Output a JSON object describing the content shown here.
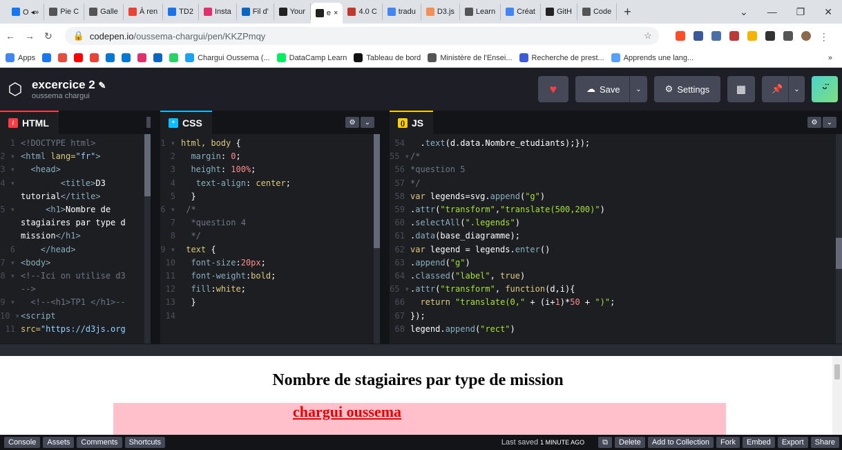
{
  "browser": {
    "tabs": [
      {
        "label": "O ◂»",
        "color": "#1877f2"
      },
      {
        "label": "Pie C",
        "color": "#555"
      },
      {
        "label": "Galle",
        "color": "#555"
      },
      {
        "label": "À ren",
        "color": "#ea4335"
      },
      {
        "label": "TD2",
        "color": "#1a73e8"
      },
      {
        "label": "Insta",
        "color": "#e1306c"
      },
      {
        "label": "Fil d'",
        "color": "#0a66c2"
      },
      {
        "label": "Your",
        "color": "#222"
      },
      {
        "label": "e",
        "color": "#222",
        "active": true
      },
      {
        "label": "4.0 C",
        "color": "#c0392b"
      },
      {
        "label": "tradu",
        "color": "#4285f4"
      },
      {
        "label": "D3.js",
        "color": "#f68e56"
      },
      {
        "label": "Learn",
        "color": "#555"
      },
      {
        "label": "Créat",
        "color": "#4285f4"
      },
      {
        "label": "GitH",
        "color": "#222"
      },
      {
        "label": "Code",
        "color": "#555"
      }
    ],
    "url_domain": "codepen.io",
    "url_path": "/oussema-chargui/pen/KKZPmqy",
    "bookmarks": [
      {
        "label": "Apps",
        "color": "#4285f4"
      },
      {
        "label": "",
        "color": "#1877f2"
      },
      {
        "label": "",
        "color": "#e74c3c"
      },
      {
        "label": "",
        "color": "#ff0000"
      },
      {
        "label": "",
        "color": "#ea4335"
      },
      {
        "label": "",
        "color": "#0078d4"
      },
      {
        "label": "",
        "color": "#0078d4"
      },
      {
        "label": "",
        "color": "#e1306c"
      },
      {
        "label": "",
        "color": "#0a66c2"
      },
      {
        "label": "",
        "color": "#25d366"
      },
      {
        "label": "Chargui Oussema (...",
        "color": "#1da1f2"
      },
      {
        "label": "DataCamp Learn",
        "color": "#03ef62"
      },
      {
        "label": "Tableau de bord",
        "color": "#111"
      },
      {
        "label": "Ministère de l'Ensei...",
        "color": "#555"
      },
      {
        "label": "Recherche de prest...",
        "color": "#3b5cd6"
      },
      {
        "label": "Apprends une lang...",
        "color": "#58a0ff"
      }
    ],
    "bookmarks_more": "»"
  },
  "codepen": {
    "title": "excercice 2",
    "author": "oussema chargui",
    "save_label": "Save",
    "settings_label": "Settings",
    "avatar_face": "̈ᴥ"
  },
  "panes": {
    "html_label": "HTML",
    "css_label": "CSS",
    "js_label": "JS"
  },
  "preview": {
    "title": "Nombre de stagiaires par type de mission",
    "name": "chargui oussema"
  },
  "footer": {
    "buttons_left": [
      "Console",
      "Assets",
      "Comments",
      "Shortcuts"
    ],
    "last_saved": "Last saved",
    "last_saved_time": "1 MINUTE AGO",
    "buttons_right": [
      "Delete",
      "Add to Collection",
      "Fork",
      "Embed",
      "Export",
      "Share"
    ]
  },
  "colors": {
    "accent_green": "#47cf73",
    "editor_bg": "#1d1e22",
    "header_bg": "#1e1f26",
    "pink": "#ffc0cb",
    "heart": "#ff3c41"
  }
}
